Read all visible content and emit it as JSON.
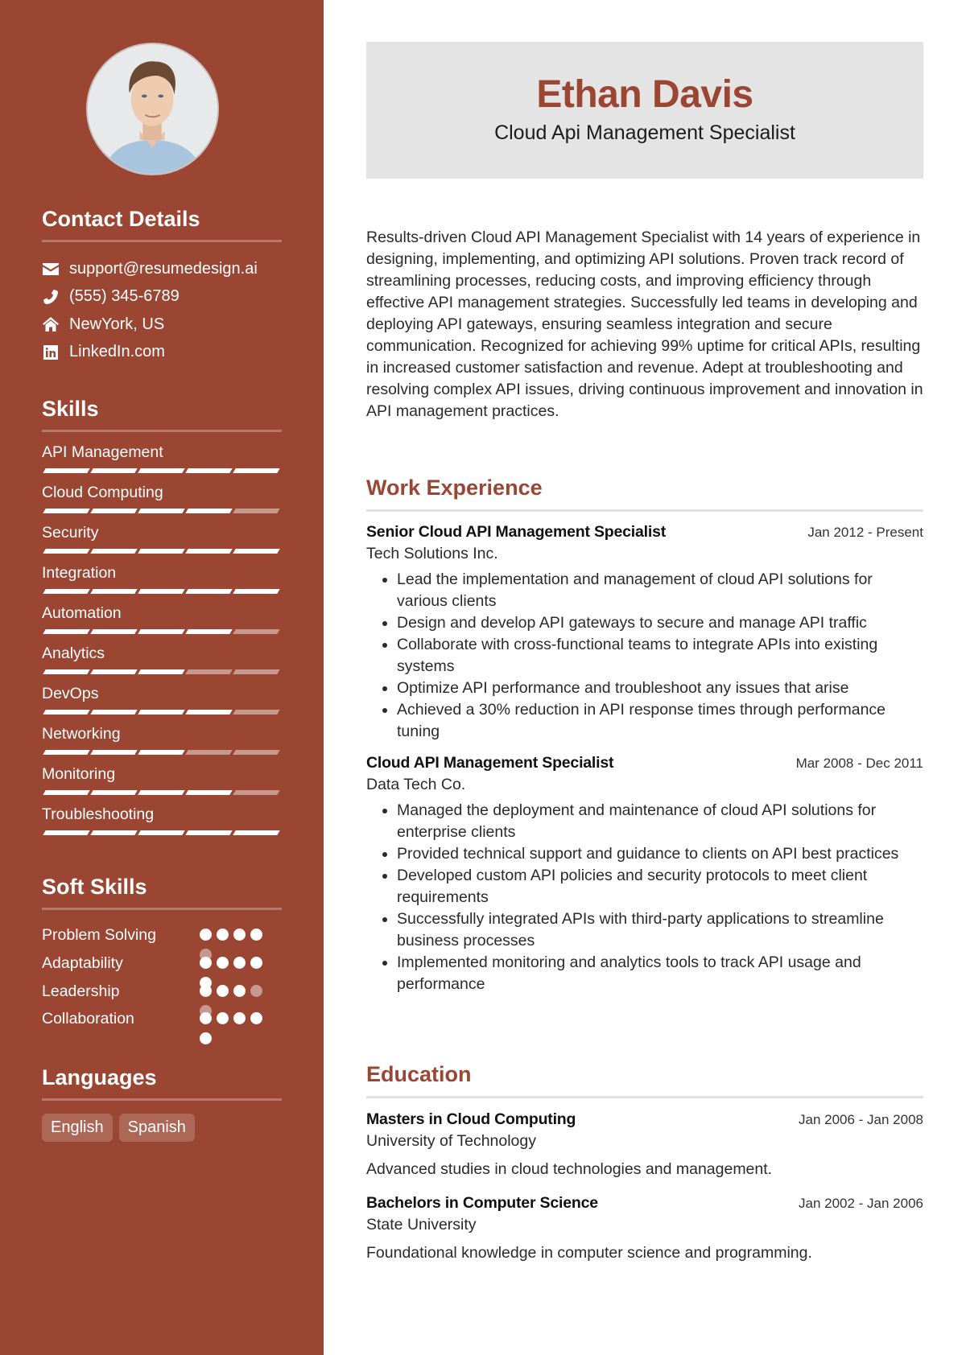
{
  "profile": {
    "name": "Ethan Davis",
    "title": "Cloud Api Management Specialist",
    "accent_color": "#9A4632"
  },
  "contact": {
    "heading": "Contact Details",
    "items": [
      {
        "icon": "envelope-icon",
        "text": "support@resumedesign.ai"
      },
      {
        "icon": "phone-icon",
        "text": "(555) 345-6789"
      },
      {
        "icon": "home-icon",
        "text": "NewYork, US"
      },
      {
        "icon": "linkedin-icon",
        "text": "LinkedIn.com"
      }
    ]
  },
  "skills": {
    "heading": "Skills",
    "max_level": 5,
    "items": [
      {
        "name": "API Management",
        "level": 5
      },
      {
        "name": "Cloud Computing",
        "level": 4
      },
      {
        "name": "Security",
        "level": 5
      },
      {
        "name": "Integration",
        "level": 5
      },
      {
        "name": "Automation",
        "level": 4
      },
      {
        "name": "Analytics",
        "level": 3
      },
      {
        "name": "DevOps",
        "level": 4
      },
      {
        "name": "Networking",
        "level": 3
      },
      {
        "name": "Monitoring",
        "level": 4
      },
      {
        "name": "Troubleshooting",
        "level": 5
      }
    ]
  },
  "soft_skills": {
    "heading": "Soft Skills",
    "max_level": 5,
    "items": [
      {
        "name": "Problem Solving",
        "level": 4
      },
      {
        "name": "Adaptability",
        "level": 5
      },
      {
        "name": "Leadership",
        "level": 3
      },
      {
        "name": "Collaboration",
        "level": 5
      }
    ]
  },
  "languages": {
    "heading": "Languages",
    "items": [
      "English",
      "Spanish"
    ]
  },
  "summary": "Results-driven Cloud API Management Specialist with 14 years of experience in designing, implementing, and optimizing API solutions. Proven track record of streamlining processes, reducing costs, and improving efficiency through effective API management strategies. Successfully led teams in developing and deploying API gateways, ensuring seamless integration and secure communication. Recognized for achieving 99% uptime for critical APIs, resulting in increased customer satisfaction and revenue. Adept at troubleshooting and resolving complex API issues, driving continuous improvement and innovation in API management practices.",
  "work": {
    "heading": "Work Experience",
    "entries": [
      {
        "role": "Senior Cloud API Management Specialist",
        "company": "Tech Solutions Inc.",
        "dates": "Jan 2012 - Present",
        "bullets": [
          "Lead the implementation and management of cloud API solutions for various clients",
          "Design and develop API gateways to secure and manage API traffic",
          "Collaborate with cross-functional teams to integrate APIs into existing systems",
          "Optimize API performance and troubleshoot any issues that arise",
          "Achieved a 30% reduction in API response times through performance tuning"
        ]
      },
      {
        "role": "Cloud API Management Specialist",
        "company": "Data Tech Co.",
        "dates": "Mar 2008 - Dec 2011",
        "bullets": [
          "Managed the deployment and maintenance of cloud API solutions for enterprise clients",
          "Provided technical support and guidance to clients on API best practices",
          "Developed custom API policies and security protocols to meet client requirements",
          "Successfully integrated APIs with third-party applications to streamline business processes",
          "Implemented monitoring and analytics tools to track API usage and performance"
        ]
      }
    ]
  },
  "education": {
    "heading": "Education",
    "entries": [
      {
        "degree": "Masters in Cloud Computing",
        "school": "University of Technology",
        "dates": "Jan 2006 - Jan 2008",
        "description": "Advanced studies in cloud technologies and management."
      },
      {
        "degree": "Bachelors in Computer Science",
        "school": "State University",
        "dates": "Jan 2002 - Jan 2006",
        "description": "Foundational knowledge in computer science and programming."
      }
    ]
  }
}
